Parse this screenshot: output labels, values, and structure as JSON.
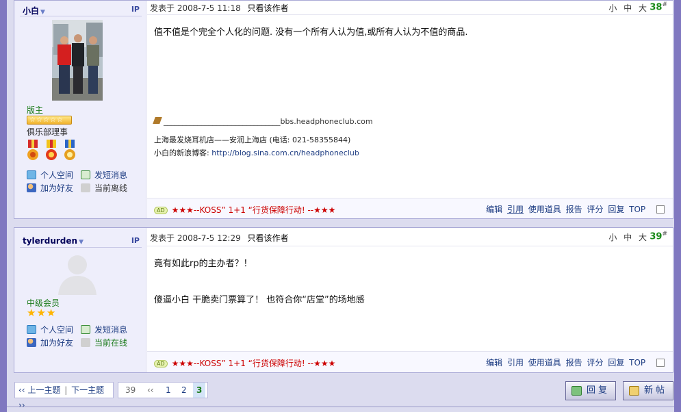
{
  "posts": [
    {
      "username": "小白",
      "ip": "IP",
      "rank": "版主",
      "badge_stars": "☆☆☆☆☆",
      "title": "俱乐部理事",
      "links": {
        "space": "个人空间",
        "pm": "发短消息",
        "add_friend": "加为好友",
        "status": "当前离线"
      },
      "posted_label": "发表于",
      "posted_time": "2008-7-5 11:18",
      "author_only": "只看该作者",
      "font_sizes": "小 中 大",
      "floor": "38",
      "floor_mark": "#",
      "content": [
        "值不值是个完全个人化的问题. 没有一个所有人认为值,或所有人认为不值的商品."
      ],
      "signature": {
        "line": "_______________________________bbs.headphoneclub.com",
        "shop": "上海最发烧耳机店——安润上海店 (电话: 021-58355844)",
        "blog_label": "小白的新浪博客:",
        "blog_url": "http://blog.sina.com.cn/headphoneclub"
      },
      "ad_badge": "AD",
      "ad_text": "★★★--KOSS” 1+1 “行货保障行动! --★★★",
      "actions": [
        "编辑",
        "引用",
        "使用道具",
        "报告",
        "评分",
        "回复",
        "TOP"
      ]
    },
    {
      "username": "tylerdurden",
      "ip": "IP",
      "rank": "中级会员",
      "stars": "★★★",
      "links": {
        "space": "个人空间",
        "pm": "发短消息",
        "add_friend": "加为好友",
        "status": "当前在线"
      },
      "posted_label": "发表于",
      "posted_time": "2008-7-5 12:29",
      "author_only": "只看该作者",
      "font_sizes": "小 中 大",
      "floor": "39",
      "floor_mark": "#",
      "content": [
        "竟有如此rp的主办者？！",
        "傻逼小白  干脆卖门票算了！  也符合你“店堂”的场地感"
      ],
      "ad_badge": "AD",
      "ad_text": "★★★--KOSS” 1+1 “行货保障行动! --★★★",
      "actions": [
        "编辑",
        "引用",
        "使用道具",
        "报告",
        "评分",
        "回复",
        "TOP"
      ]
    }
  ],
  "pager": {
    "prev_topic": "上一主题",
    "next_topic": "下一主题",
    "prev_mark": "‹‹",
    "next_mark": "››",
    "total": "39",
    "pages": [
      "1",
      "2",
      "3"
    ],
    "current": "3"
  },
  "buttons": {
    "reply": "回复",
    "new_post": "新帖"
  },
  "colors": {
    "accent": "#8078c0",
    "link": "#1d3c82",
    "floor": "#1a8a1a",
    "ad": "#cc0000"
  }
}
